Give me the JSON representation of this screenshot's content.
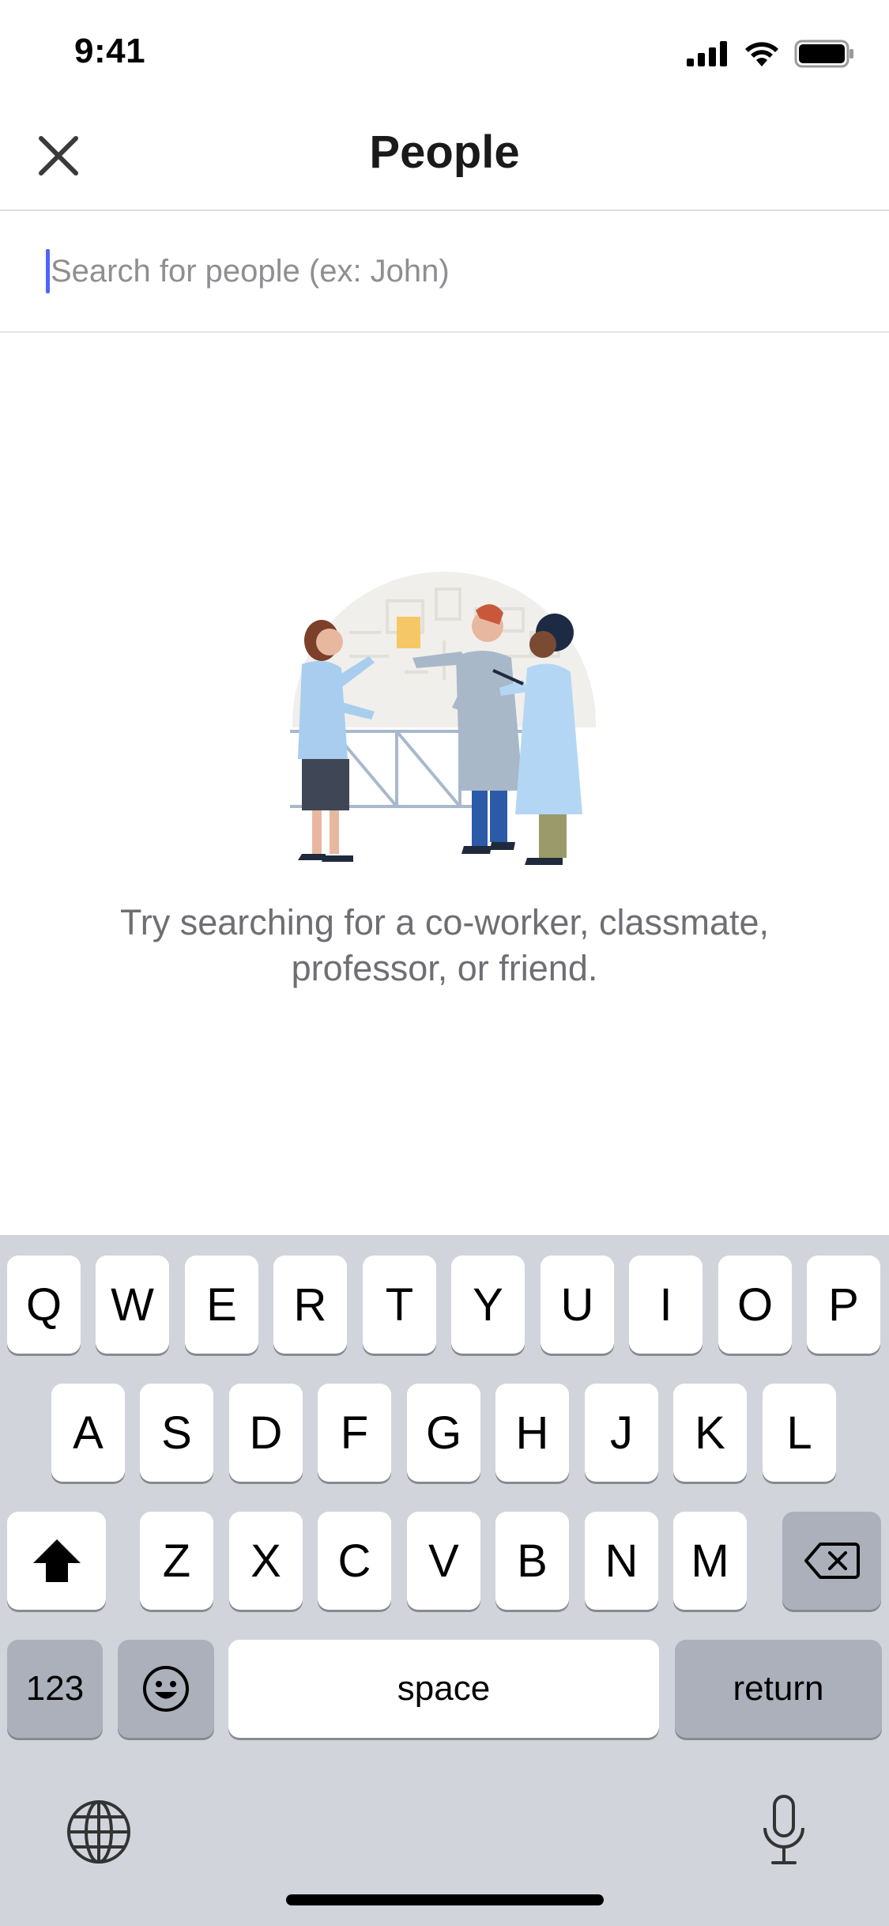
{
  "status": {
    "time": "9:41",
    "icons": [
      "signal-icon",
      "wifi-icon",
      "battery-icon"
    ]
  },
  "nav": {
    "title": "People",
    "close_icon": "close-icon"
  },
  "search": {
    "placeholder": "Search for people (ex: John)",
    "value": ""
  },
  "empty_state": {
    "illustration": "people-collaborating-illustration",
    "message": "Try searching for a co-worker, classmate, professor, or friend."
  },
  "keyboard": {
    "row1": [
      "Q",
      "W",
      "E",
      "R",
      "T",
      "Y",
      "U",
      "I",
      "O",
      "P"
    ],
    "row2": [
      "A",
      "S",
      "D",
      "F",
      "G",
      "H",
      "J",
      "K",
      "L"
    ],
    "row3": [
      "Z",
      "X",
      "C",
      "V",
      "B",
      "N",
      "M"
    ],
    "numbers_label": "123",
    "space_label": "space",
    "return_label": "return",
    "icons": [
      "shift-icon",
      "backspace-icon",
      "emoji-icon",
      "globe-icon",
      "microphone-icon"
    ]
  },
  "colors": {
    "accent": "#4f63ff",
    "keyboard_bg": "#d1d4db",
    "dark_key": "#abb0bb"
  }
}
